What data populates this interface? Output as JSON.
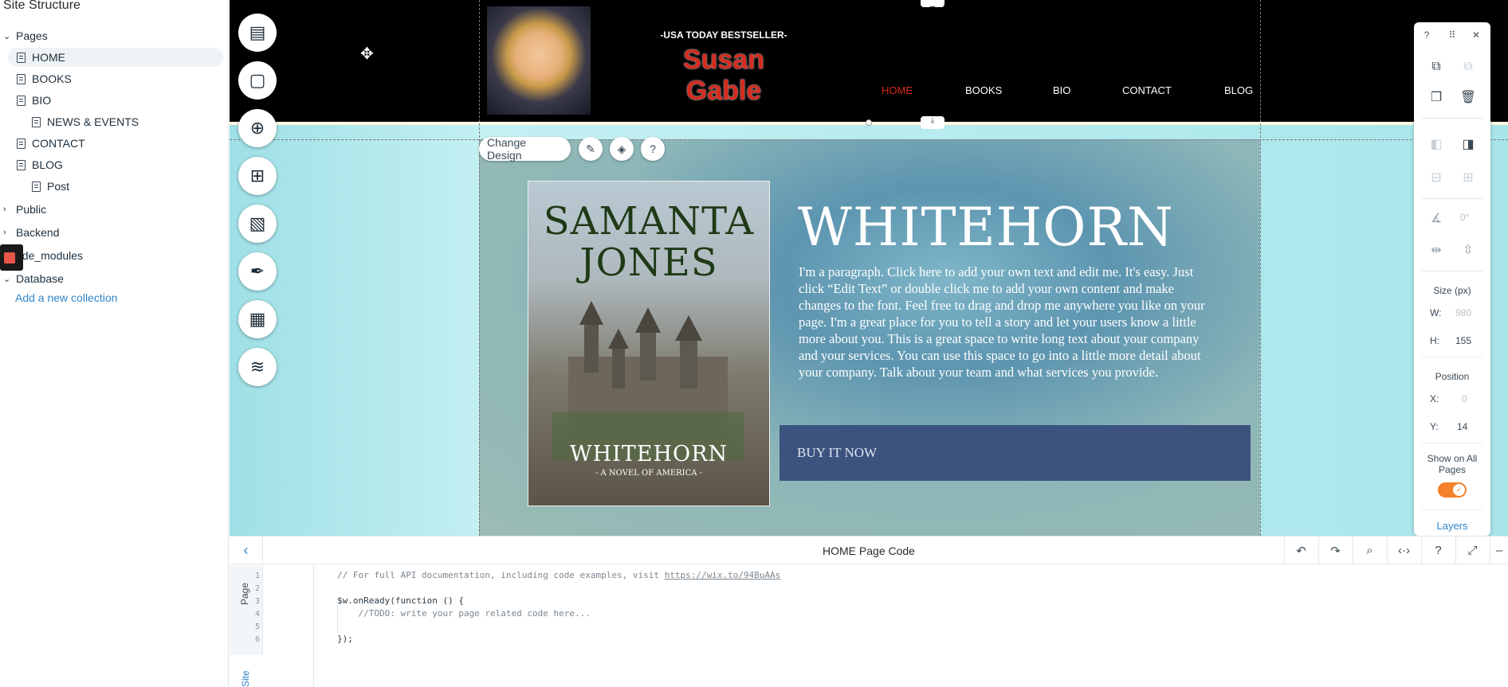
{
  "sidebar": {
    "title": "Site Structure",
    "pages_label": "Pages",
    "pages": [
      "HOME",
      "BOOKS",
      "BIO",
      "NEWS & EVENTS",
      "CONTACT",
      "BLOG",
      "Post"
    ],
    "public_label": "Public",
    "backend_label": "Backend",
    "node_modules_label": "ode_modules",
    "database_label": "Database",
    "add_collection": "Add a new collection"
  },
  "site": {
    "tagline": "-USA TODAY BESTSELLER-",
    "author": "Susan Gable",
    "nav": [
      "HOME",
      "BOOKS",
      "BIO",
      "CONTACT",
      "BLOG"
    ],
    "change_design": "Change Design",
    "book_title_line1": "SAMANTA",
    "book_title_line2": "JONES",
    "book_subtitle": "WHITEHORN",
    "book_series": "- A NOVEL OF AMERICA -",
    "headline": "WHITEHORN",
    "paragraph": "I'm a paragraph. Click here to add your own text and edit me. It's easy. Just click “Edit Text” or double click me to add your own content and make changes to the font. Feel free to drag and drop me anywhere you like on your page. I'm a great place for you to tell a story and let your users know a little more about you. This is a great space to write long text about your company and your services. You can use this space to go into a little more detail about your company. Talk about your team and what services you provide.",
    "buy_button": "BUY IT NOW",
    "nav_active_color": "#d52b1e",
    "author_color": "#d52b1e"
  },
  "inspector": {
    "angle": "0°",
    "size_label": "Size (px)",
    "w_label": "W:",
    "w_value": "980",
    "h_label": "H:",
    "h_value": "155",
    "position_label": "Position",
    "x_label": "X:",
    "x_value": "0",
    "y_label": "Y:",
    "y_value": "14",
    "show_all_label": "Show on All Pages",
    "show_all_on": true,
    "layers_label": "Layers",
    "toggle_color": "#f5822b"
  },
  "code_panel": {
    "title": "HOME Page Code",
    "tab_page": "Page",
    "tab_site": "Site",
    "line_numbers": [
      "1",
      "2",
      "3",
      "4",
      "5",
      "6"
    ],
    "lines": [
      "// For full API documentation, including code examples, visit ",
      "",
      "$w.onReady(function () {",
      "    //TODO: write your page related code here...",
      "",
      "});"
    ],
    "doc_link": "https://wix.to/94BuAAs"
  }
}
